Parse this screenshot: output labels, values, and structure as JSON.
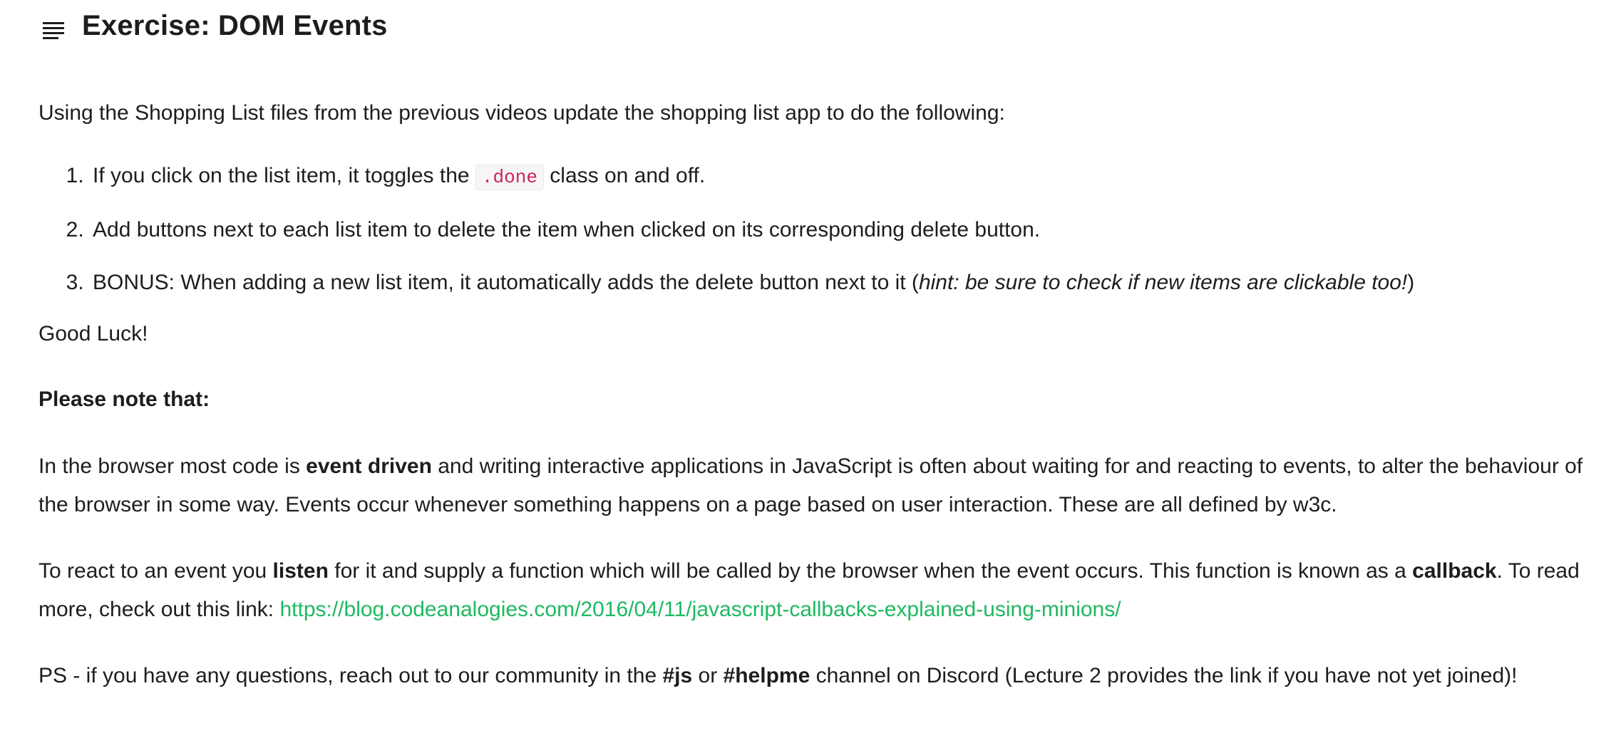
{
  "header": {
    "icon": "list-menu-icon",
    "title": "Exercise: DOM Events"
  },
  "intro": "Using the Shopping List files from the previous videos update the shopping list app to do the following:",
  "tasks": [
    {
      "before": "If you click on the list item, it toggles the ",
      "code": ".done",
      "after": " class on and off."
    },
    {
      "text": "Add buttons next to each list item to delete the item when clicked on its corresponding delete button."
    },
    {
      "before": "BONUS: When adding a new list item, it automatically adds the delete button next to it (",
      "hint": "hint: be sure to check if new items are clickable too!",
      "after": ")"
    }
  ],
  "good_luck": "Good Luck!",
  "note_heading": "Please note that:",
  "para1": {
    "before": "In the browser most code is ",
    "bold": "event driven",
    "after": " and writing interactive applications in JavaScript is often about waiting for and reacting to events, to alter the behaviour of the browser in some way. Events occur whenever something happens on a page based on user interaction. These are all defined by w3c."
  },
  "para2": {
    "before": "To react to an event you ",
    "bold1": "listen",
    "middle": " for it and supply a function which will be called by the browser when the event occurs. This function is known as a ",
    "bold2": "callback",
    "after": ". To read more, check out this link: ",
    "link": "https://blog.codeanalogies.com/2016/04/11/javascript-callbacks-explained-using-minions/"
  },
  "ps": {
    "before": "PS - if you have any questions, reach out to our community in the ",
    "tag1": "#js",
    "or": " or ",
    "tag2": "#helpme",
    "after": " channel on Discord (Lecture 2 provides the link if you have not yet joined)!"
  },
  "colors": {
    "text": "#1c1d1f",
    "code": "#cc2455",
    "link": "#1eb960"
  }
}
